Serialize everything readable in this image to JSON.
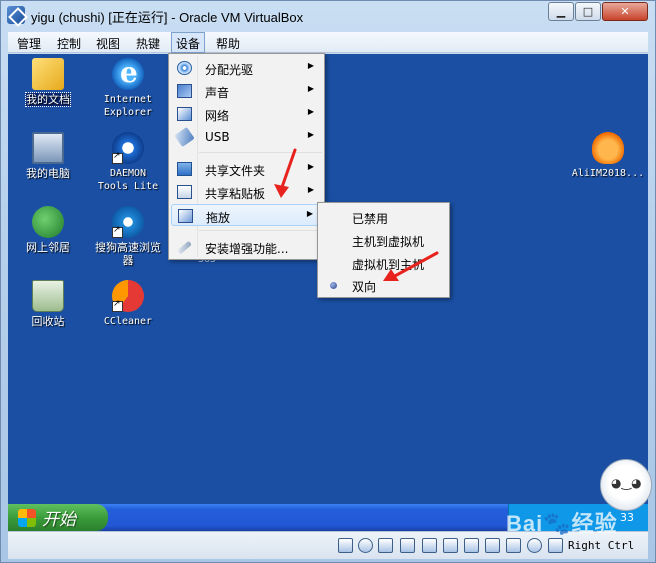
{
  "window": {
    "title": "yigu (chushi) [正在运行] - Oracle VM VirtualBox",
    "controls": {
      "minimize": "▁",
      "maximize": "□",
      "close": "✕"
    }
  },
  "menubar": {
    "items": [
      "管理",
      "控制",
      "视图",
      "热键",
      "设备",
      "帮助"
    ],
    "active": "设备"
  },
  "devices_menu": {
    "items": [
      {
        "label": "分配光驱",
        "icon": "cd-icon",
        "submenu": true
      },
      {
        "label": "声音",
        "icon": "audio-icon",
        "submenu": true
      },
      {
        "label": "网络",
        "icon": "network-icon",
        "submenu": true
      },
      {
        "label": "USB",
        "icon": "usb-icon",
        "submenu": true
      },
      {
        "label": "共享文件夹",
        "icon": "shared-folder-icon",
        "submenu": true
      },
      {
        "label": "共享粘贴板",
        "icon": "clipboard-icon",
        "submenu": true
      },
      {
        "label": "拖放",
        "icon": "drag-drop-icon",
        "submenu": true,
        "highlighted": true
      },
      {
        "label": "安装增强功能...",
        "icon": "install-icon",
        "submenu": false
      }
    ],
    "arrow_glyph": "▶"
  },
  "dragdrop_submenu": {
    "items": [
      {
        "label": "已禁用",
        "selected": false
      },
      {
        "label": "主机到虚拟机",
        "selected": false
      },
      {
        "label": "虚拟机到主机",
        "selected": false
      },
      {
        "label": "双向",
        "selected": true
      }
    ]
  },
  "desktop": {
    "icons": [
      {
        "label": "我的文档",
        "icon": "my-documents-icon",
        "selected": true
      },
      {
        "label": "Internet Explorer",
        "icon": "internet-explorer-icon"
      },
      {
        "label": "我的电脑",
        "icon": "my-computer-icon"
      },
      {
        "label": "DAEMON Tools Lite",
        "icon": "daemon-tools-icon"
      },
      {
        "label": "网上邻居",
        "icon": "network-places-icon"
      },
      {
        "label": "搜狗高速浏览器",
        "icon": "sogou-browser-icon"
      },
      {
        "label": "回收站",
        "icon": "recycle-bin-icon"
      },
      {
        "label": "CCleaner",
        "icon": "ccleaner-icon"
      },
      {
        "label": "AliIM2018...",
        "icon": "aliim-icon"
      }
    ],
    "partial_text": "365"
  },
  "taskbar": {
    "start_label": "开始",
    "clock": "33"
  },
  "statusbar": {
    "host_key": "Right Ctrl"
  },
  "watermark": {
    "text": "Bai🐾经验"
  },
  "colors": {
    "desktop_bg": "#1a4fa3",
    "annotation_red": "#e8231d",
    "taskbar_blue": "#245edb",
    "start_green": "#3a9d3a"
  }
}
